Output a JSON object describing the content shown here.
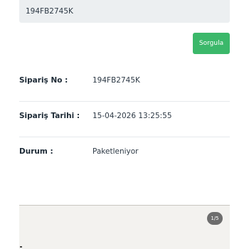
{
  "search": {
    "value": "194FB2745K",
    "button_label": "Sorgula"
  },
  "order": {
    "rows": [
      {
        "label": "Sipariş No :",
        "value": "194FB2745K"
      },
      {
        "label": "Sipariş Tarihi :",
        "value": "15-04-2026 13:25:55"
      },
      {
        "label": "Durum :",
        "value": "Paketleniyor"
      }
    ]
  },
  "gallery": {
    "page_indicator": "1/5"
  }
}
